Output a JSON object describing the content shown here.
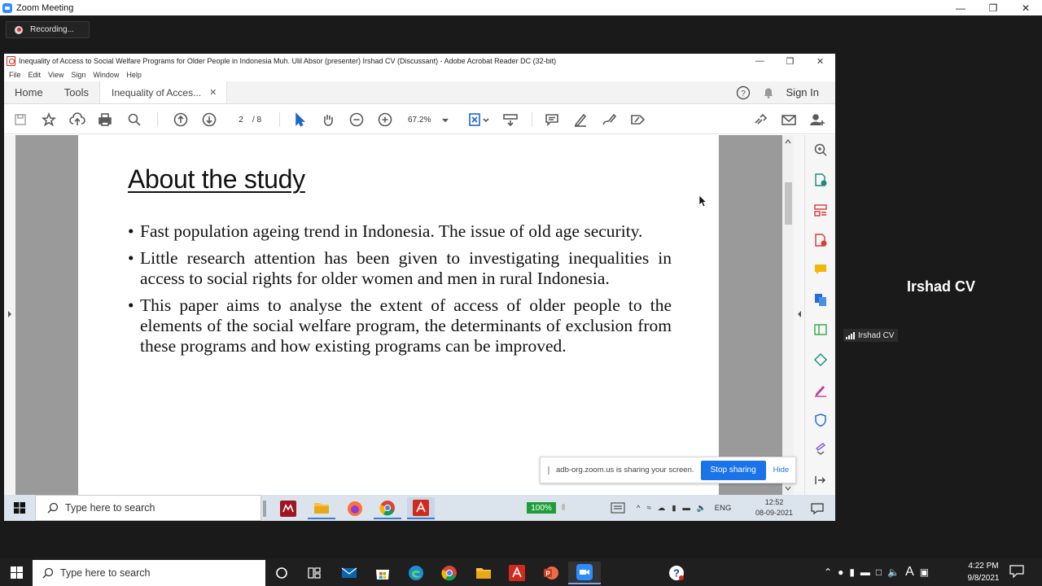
{
  "zoom": {
    "window_title": "Zoom Meeting",
    "recording_label": "Recording..."
  },
  "acrobat": {
    "window_title": "Inequality of Access to Social Welfare Programs for Older People in Indonesia    Muh. Ulil Absor (presenter)    Irshad CV (Discussant) - Adobe Acrobat Reader DC (32-bit)",
    "menu": [
      "File",
      "Edit",
      "View",
      "Sign",
      "Window",
      "Help"
    ],
    "tabs": {
      "home": "Home",
      "tools": "Tools",
      "document": "Inequality of Acces..."
    },
    "sign_in": "Sign In",
    "page_current": "2",
    "page_total": "/ 8",
    "zoom_level": "67.2%"
  },
  "slide": {
    "title": "About the study",
    "bullets": [
      "Fast population ageing trend in Indonesia. The issue of old age security.",
      "Little research attention has been given to investigating inequalities in access to social rights for older women and men in rural Indonesia.",
      "This paper aims to analyse the extent of access of older people to the elements of the social welfare program, the determinants of exclusion from these programs and how existing programs can be improved."
    ]
  },
  "share_bar": {
    "message": "adb-org.zoom.us is sharing your screen.",
    "stop_label": "Stop sharing",
    "hide_label": "Hide"
  },
  "inner_taskbar": {
    "search_placeholder": "Type here to search",
    "battery": "100%",
    "language": "ENG",
    "time": "12:52",
    "date": "08-09-2021"
  },
  "participant": {
    "name": "Irshad CV",
    "tag_name": "Irshad CV"
  },
  "taskbar": {
    "search_placeholder": "Type here to search",
    "time": "4:22 PM",
    "date": "9/8/2021"
  },
  "colors": {
    "zoom_blue": "#2d8cff",
    "stop_sharing": "#1a73e8",
    "acrobat_red": "#d02a1e"
  }
}
